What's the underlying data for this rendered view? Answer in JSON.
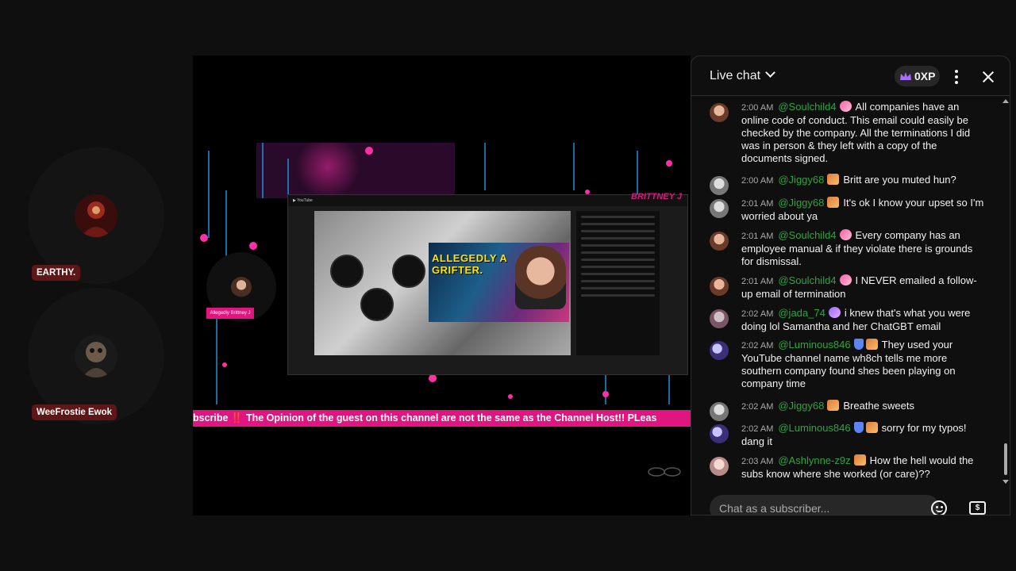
{
  "participants": [
    {
      "name": "EARTHY."
    },
    {
      "name": "WeeFrostie Ewok"
    }
  ],
  "stage": {
    "ticker_text": "bscribe ‼️ The Opinion of the guest on this channel are not the same as the Channel Host!! PLeas",
    "brand_name": "BRITTNEY J",
    "cam_label": "Allegedly Brittney J",
    "inner_title": "ALLEGEDLY A GRIFTER."
  },
  "chat": {
    "title": "Live chat",
    "xp": "0XP",
    "input_placeholder": "Chat as a subscriber...",
    "messages": [
      {
        "time": "2:00 AM",
        "author": "@Soulchild4",
        "badge": "pink",
        "text": "All companies have an online code of conduct. This email could easily be checked by the company. All the terminations I did was in person & they left with a copy of the documents signed."
      },
      {
        "time": "2:00 AM",
        "author": "@Jiggy68",
        "badge": "member",
        "text": "Britt are you muted hun?"
      },
      {
        "time": "2:01 AM",
        "author": "@Jiggy68",
        "badge": "member",
        "text": "It's ok I know your upset so I'm worried about ya"
      },
      {
        "time": "2:01 AM",
        "author": "@Soulchild4",
        "badge": "pink",
        "text": "Every company has an employee manual & if they violate there is grounds for dismissal."
      },
      {
        "time": "2:01 AM",
        "author": "@Soulchild4",
        "badge": "pink",
        "text": "I NEVER emailed a follow-up email of termination"
      },
      {
        "time": "2:02 AM",
        "author": "@jada_74",
        "badge": "purple",
        "text": "i knew that's what you were doing lol Samantha and her ChatGBT email"
      },
      {
        "time": "2:02 AM",
        "author": "@Luminous846",
        "badge": "shield",
        "text": "They used your YouTube channel name wh8ch tells me more southern company found shes been playing on company time"
      },
      {
        "time": "2:02 AM",
        "author": "@Jiggy68",
        "badge": "member",
        "text": "Breathe sweets"
      },
      {
        "time": "2:02 AM",
        "author": "@Luminous846",
        "badge": "shield",
        "text": "sorry for my typos! dang it"
      },
      {
        "time": "2:03 AM",
        "author": "@Ashlynne-z9z",
        "badge": "member",
        "text": "How the hell would the subs know where she worked (or care)??"
      }
    ]
  }
}
